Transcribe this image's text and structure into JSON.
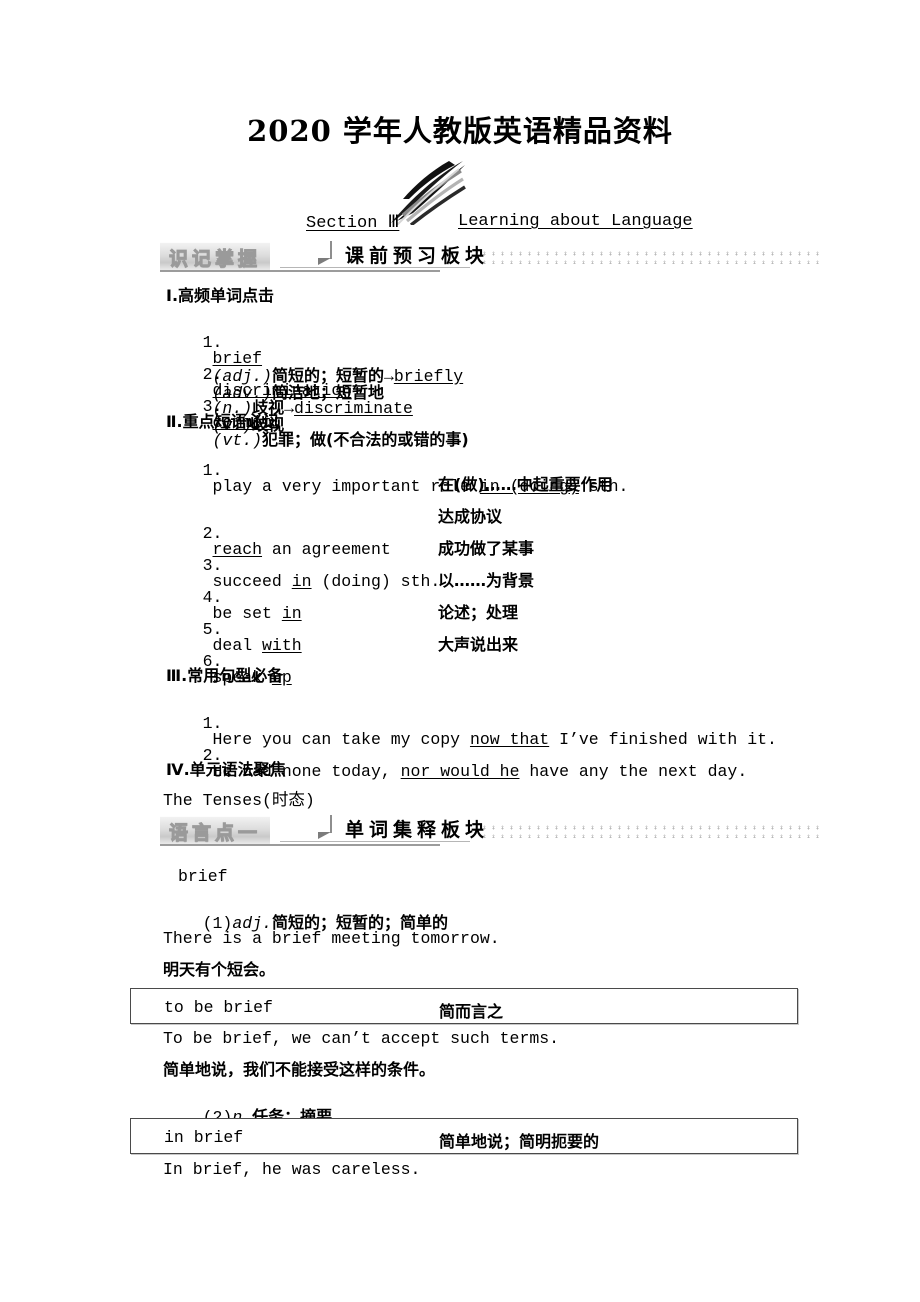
{
  "masthead": {
    "title": "2020 学年人教版英语精品资料"
  },
  "section_header": {
    "label": "Section Ⅲ",
    "title": "Learning about Language",
    "decoration_icon": "swoosh-arrow-icon"
  },
  "banners": [
    {
      "tag": "识记掌握",
      "title": "课前预习板块"
    },
    {
      "tag": "语言点一",
      "title": "单词集释板块"
    }
  ],
  "preview": {
    "part1": {
      "heading": "Ⅰ.高频单词点击",
      "items": [
        {
          "num": "1.",
          "word": "brief",
          "pos": "(adj.)",
          "meaning": "简短的；短暂的",
          "arrow": "→",
          "derived": "briefly",
          "derived_pos": "(adv.)",
          "derived_meaning": "简洁地；短暂地"
        },
        {
          "num": "2.",
          "word": "discrimination",
          "pos": "(n.)",
          "meaning": "歧视",
          "arrow": "→",
          "derived": "discriminate",
          "derived_pos": "(v.)",
          "derived_meaning": "歧视"
        },
        {
          "num": "3.",
          "word": "commit",
          "pos": "(vt.)",
          "meaning": "犯罪；做(不合法的或错的事)",
          "arrow": "",
          "derived": "",
          "derived_pos": "",
          "derived_meaning": ""
        }
      ]
    },
    "part2": {
      "heading": "Ⅱ.重点短语必记",
      "items": [
        {
          "num": "1.",
          "en_pre": "play a very important role ",
          "en_ul": "in (doing)",
          "en_post": " sth.",
          "cn": "在(做)……中起重要作用",
          "cn_on_next_line": true
        },
        {
          "num": "2.",
          "en_pre": "",
          "en_ul": "reach",
          "en_post": " an agreement",
          "cn": "达成协议",
          "cn_on_next_line": false
        },
        {
          "num": "3.",
          "en_pre": "succeed ",
          "en_ul": "in",
          "en_post": " (doing) sth.",
          "cn": "成功做了某事",
          "cn_on_next_line": false
        },
        {
          "num": "4.",
          "en_pre": "be set ",
          "en_ul": "in",
          "en_post": "",
          "cn": "以……为背景",
          "cn_on_next_line": false
        },
        {
          "num": "5.",
          "en_pre": "deal ",
          "en_ul": "with",
          "en_post": "",
          "cn": "论述；处理",
          "cn_on_next_line": false
        },
        {
          "num": "6.",
          "en_pre": "speak ",
          "en_ul": "up",
          "en_post": "",
          "cn": "大声说出来",
          "cn_on_next_line": false
        }
      ]
    },
    "part3": {
      "heading": "Ⅲ.常用句型必备",
      "items": [
        {
          "num": "1.",
          "pre": "Here you can take my copy ",
          "ul": "now that",
          "post": " I’ve finished with it."
        },
        {
          "num": "2.",
          "pre": "He had none today, ",
          "ul": "nor would he",
          "post": " have any the next day."
        }
      ]
    },
    "part4": {
      "heading": "Ⅳ.单元语法聚焦",
      "content": "The Tenses(时态)"
    }
  },
  "word_entry": {
    "headword": "brief",
    "sense1": {
      "marker": "(1)",
      "pos": "adj.",
      "meaning": "简短的；短暂的；简单的",
      "example_en": "There is a brief meeting tomorrow.",
      "example_cn": "明天有个短会。",
      "phrase_box": {
        "en": "to be brief",
        "cn": "简而言之"
      },
      "phrase_example_en": "To be brief, we can’t accept such terms.",
      "phrase_example_cn": "简单地说，我们不能接受这样的条件。"
    },
    "sense2": {
      "marker": "(2)",
      "pos": "n.",
      "meaning": "任务；摘要",
      "phrase_box": {
        "en": "in brief",
        "cn": "简单地说；简明扼要的"
      },
      "phrase_example_en": "In brief, he was careless."
    }
  },
  "colors": {
    "text": "#000000",
    "banner_tag_fill": "#f4f4f4",
    "banner_tag_stroke": "#9a9a9a",
    "rule": "#9c9c9c",
    "box_border": "#4a4a4a",
    "page_bg": "#ffffff"
  }
}
